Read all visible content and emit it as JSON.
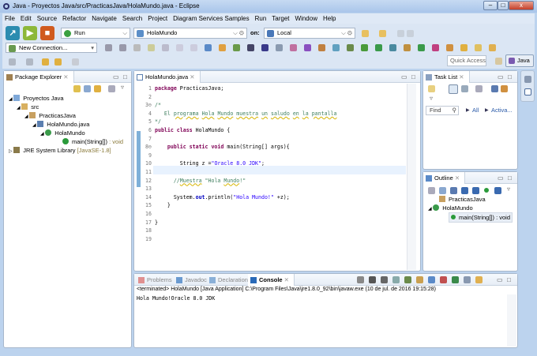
{
  "window": {
    "title": "Java - Proyectos Java/src/PracticasJava/HolaMundo.java - Eclipse"
  },
  "menu": [
    "File",
    "Edit",
    "Source",
    "Refactor",
    "Navigate",
    "Search",
    "Project",
    "Diagram Services Samples",
    "Run",
    "Target",
    "Window",
    "Help"
  ],
  "toolbar": {
    "run_config": "Run",
    "launch_target": "HolaMundo",
    "on_label": "on:",
    "target": "Local",
    "connection": "New Connection...",
    "quick_access": "Quick Access",
    "perspective": "Java"
  },
  "package_explorer": {
    "title": "Package Explorer",
    "tree": [
      {
        "label": "Proyectos Java",
        "level": 0
      },
      {
        "label": "src",
        "level": 1
      },
      {
        "label": "PracticasJava",
        "level": 2
      },
      {
        "label": "HolaMundo.java",
        "level": 3
      },
      {
        "label": "HolaMundo",
        "level": 4
      },
      {
        "label": "main(String[])",
        "suffix": " : void",
        "level": 5
      },
      {
        "label": "JRE System Library",
        "suffix": " [JavaSE-1.8]",
        "level": 0
      }
    ]
  },
  "editor": {
    "tab": "HolaMundo.java",
    "lines": [
      [
        {
          "t": "package",
          "c": "kw"
        },
        {
          "t": " PracticasJava;"
        }
      ],
      [],
      [
        {
          "t": "/*",
          "c": "cm"
        }
      ],
      [
        {
          "t": "   El ",
          "c": "cm"
        },
        {
          "t": "programa",
          "c": "cm ul"
        },
        {
          "t": " ",
          "c": "cm"
        },
        {
          "t": "Hola",
          "c": "cm ul"
        },
        {
          "t": " ",
          "c": "cm"
        },
        {
          "t": "Mundo",
          "c": "cm ul"
        },
        {
          "t": " ",
          "c": "cm"
        },
        {
          "t": "muestra",
          "c": "cm ul"
        },
        {
          "t": " ",
          "c": "cm"
        },
        {
          "t": "un",
          "c": "cm ul"
        },
        {
          "t": " ",
          "c": "cm"
        },
        {
          "t": "saludo",
          "c": "cm ul"
        },
        {
          "t": " ",
          "c": "cm"
        },
        {
          "t": "en",
          "c": "cm ul"
        },
        {
          "t": " ",
          "c": "cm"
        },
        {
          "t": "la",
          "c": "cm ul"
        },
        {
          "t": " ",
          "c": "cm"
        },
        {
          "t": "pantalla",
          "c": "cm ul"
        }
      ],
      [
        {
          "t": "*/",
          "c": "cm"
        }
      ],
      [
        {
          "t": "public class",
          "c": "kw"
        },
        {
          "t": " HolaMundo {"
        }
      ],
      [],
      [
        {
          "t": "    "
        },
        {
          "t": "public static void",
          "c": "kw"
        },
        {
          "t": " main(String[] args){"
        }
      ],
      [],
      [
        {
          "t": "        String z =",
          "c": ""
        },
        {
          "t": "\"Oracle 8.0 JDK\"",
          "c": "str"
        },
        {
          "t": ";"
        }
      ],
      [],
      [
        {
          "t": "      //",
          "c": "cm"
        },
        {
          "t": "Muestra",
          "c": "cm ul"
        },
        {
          "t": " \"Hola ",
          "c": "cm"
        },
        {
          "t": "Mundo",
          "c": "cm ul"
        },
        {
          "t": "!\"",
          "c": "cm"
        }
      ],
      [],
      [
        {
          "t": "      System."
        },
        {
          "t": "out",
          "c": "fld"
        },
        {
          "t": ".println("
        },
        {
          "t": "\"Hola Mundo!\"",
          "c": "str"
        },
        {
          "t": " +z);"
        }
      ],
      [
        {
          "t": "    }"
        }
      ],
      [],
      [
        {
          "t": "}"
        }
      ],
      [],
      []
    ]
  },
  "task_list": {
    "title": "Task List",
    "find": "Find",
    "all": "All",
    "activate": "Activa..."
  },
  "outline": {
    "title": "Outline",
    "items": [
      {
        "label": "PracticasJava"
      },
      {
        "label": "HolaMundo"
      },
      {
        "label": "main(String[]) : void"
      }
    ]
  },
  "bottom": {
    "tabs": [
      "Problems",
      "Javadoc",
      "Declaration",
      "Console"
    ],
    "status": "<terminated> HolaMundo [Java Application] C:\\Program Files\\Java\\jre1.8.0_92\\bin\\javaw.exe (10 de jul. de 2016 19:15:28)",
    "output": "Hola Mundo!Oracle 8.0 JDK"
  }
}
